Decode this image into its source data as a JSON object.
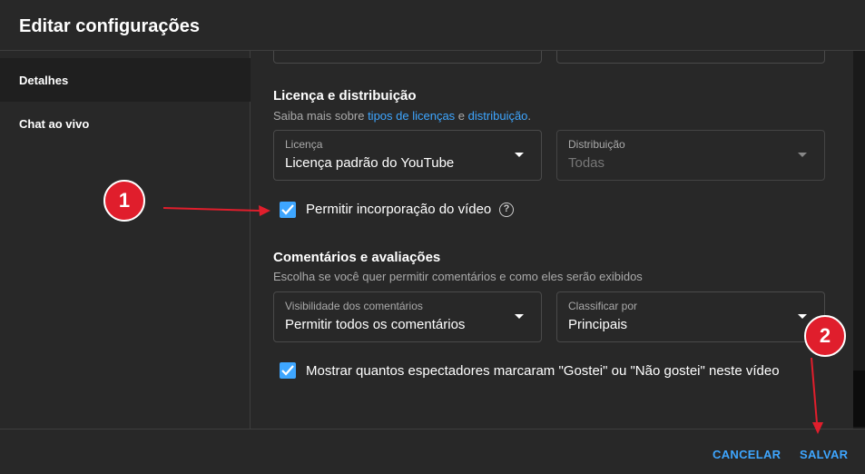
{
  "dialog": {
    "title": "Editar configurações"
  },
  "sidebar": {
    "items": [
      {
        "label": "Detalhes"
      },
      {
        "label": "Chat ao vivo"
      }
    ]
  },
  "license_section": {
    "title": "Licença e distribuição",
    "subtitle_prefix": "Saiba mais sobre ",
    "link1": "tipos de licenças",
    "conj": " e ",
    "link2": "distribuição",
    "suffix": "."
  },
  "license_field": {
    "label": "Licença",
    "value": "Licença padrão do YouTube"
  },
  "distribution_field": {
    "label": "Distribuição",
    "value": "Todas"
  },
  "embed_checkbox": {
    "label": "Permitir incorporação do vídeo",
    "checked": true,
    "help_icon": "help-circle-icon"
  },
  "comments_section": {
    "title": "Comentários e avaliações",
    "subtitle": "Escolha se você quer permitir comentários e como eles serão exibidos"
  },
  "comments_visibility": {
    "label": "Visibilidade dos comentários",
    "value": "Permitir todos os comentários"
  },
  "sort_by": {
    "label": "Classificar por",
    "value": "Principais"
  },
  "ratings_checkbox": {
    "label": "Mostrar quantos espectadores marcaram \"Gostei\" ou \"Não gostei\" neste vídeo",
    "checked": true
  },
  "footer": {
    "cancel": "CANCELAR",
    "save": "SALVAR"
  },
  "annotations": {
    "badge1": "1",
    "badge2": "2",
    "color": "#e01e2c"
  },
  "colors": {
    "background": "#282828",
    "accent": "#3ea6ff",
    "sidebar_active": "#1f1f1f"
  }
}
